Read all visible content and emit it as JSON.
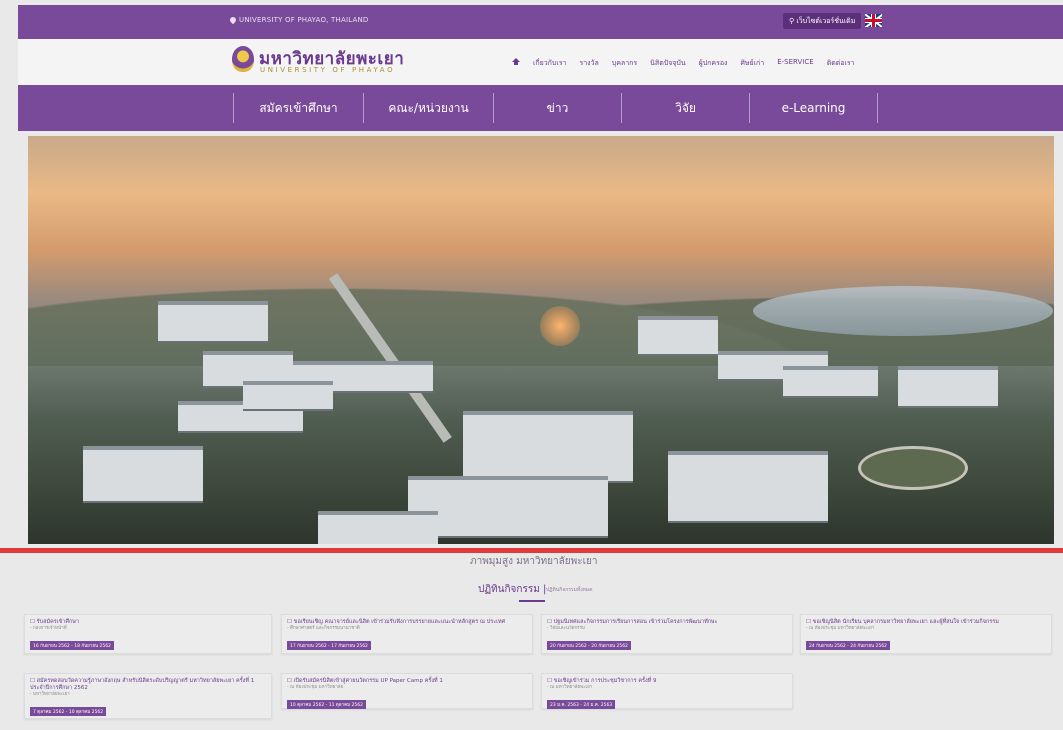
{
  "topbar": {
    "location": "UNIVERSITY OF PHAYAO, THAILAND",
    "english_site_button": "เว็บไซต์เวอร์ชั่นเดิม"
  },
  "header": {
    "logo_th": "มหาวิทยาลัยพะเยา",
    "logo_en": "UNIVERSITY OF PHAYAO",
    "nav": [
      "เกี่ยวกับเรา",
      "รางวัล",
      "บุคลากร",
      "นิสิตปัจจุบัน",
      "ผู้ปกครอง",
      "ศิษย์เก่า",
      "E-SERVICE",
      "ติดต่อเรา"
    ]
  },
  "main_menu": [
    "สมัครเข้าศึกษา",
    "คณะ/หน่วยงาน",
    "ข่าว",
    "วิจัย",
    "e-Learning"
  ],
  "hero": {
    "caption": "ภาพมุมสูง มหาวิทยาลัยพะเยา"
  },
  "activities": {
    "title": "ปฏิทินกิจกรรม |",
    "subtitle": "ปฏิทินกิจกรรมทั้งหมด",
    "cards": [
      {
        "title": "☐ รับสมัครเข้าศึกษา",
        "sub": "- กองการเจ้าหน้าที่",
        "date": "16 กันยายน 2562 - 18 กันยายน 2562"
      },
      {
        "title": "☐ ขอเรียนเชิญ คณาจารย์และนิสิต เข้าร่วมรับฟังการบรรยายและแนะนำหลักสูตร ณ ประเทศ",
        "sub": "- ศึกษาศาสตร์ และกิจกรรมนานาชาติ",
        "date": "17 กันยายน 2562 - 17 กันยายน 2562"
      },
      {
        "title": "☐ ปฐมนิเทศและกิจกรรมการเรียนการสอน เข้าร่วมโครงการพัฒนาทักษะ",
        "sub": "- วิจัยและนวัตกรรม",
        "date": "20 กันยายน 2562 - 20 กันยายน 2562"
      },
      {
        "title": "☐ ขอเชิญนิสิต นักเรียน บุคลากรมหาวิทยาลัยพะเยา และผู้ที่สนใจ เข้าร่วมกิจกรรม",
        "sub": "- ณ ห้องประชุม มหาวิทยาลัยพะเยา",
        "date": "24 กันยายน 2562 - 24 กันยายน 2562"
      },
      {
        "title": "☐ สมัครทดสอบวัดความรู้ภาษาอังกฤษ สำหรับนิสิตระดับปริญญาตรี มหาวิทยาลัยพะเยา ครั้งที่ 1 ประจำปีการศึกษา 2562",
        "sub": "- มหาวิทยาลัยพะเยา",
        "date": "7 ตุลาคม 2562 - 10 ตุลาคม 2562"
      },
      {
        "title": "☐ เปิดรับสมัครนิสิตเข้าสู่ค่ายนวัตกรรม UP Paper Camp ครั้งที่ 1",
        "sub": "- ณ ห้องประชุม มหาวิทยาลัย",
        "date": "10 ตุลาคม 2562 - 11 ตุลาคม 2562"
      },
      {
        "title": "☐ ขอเชิญเข้าร่วม การประชุมวิชาการ ครั้งที่ 9",
        "sub": "- ณ มหาวิทยาลัยพะเยา",
        "date": "23 ม.ค. 2563 - 24 ม.ค. 2563"
      }
    ]
  }
}
